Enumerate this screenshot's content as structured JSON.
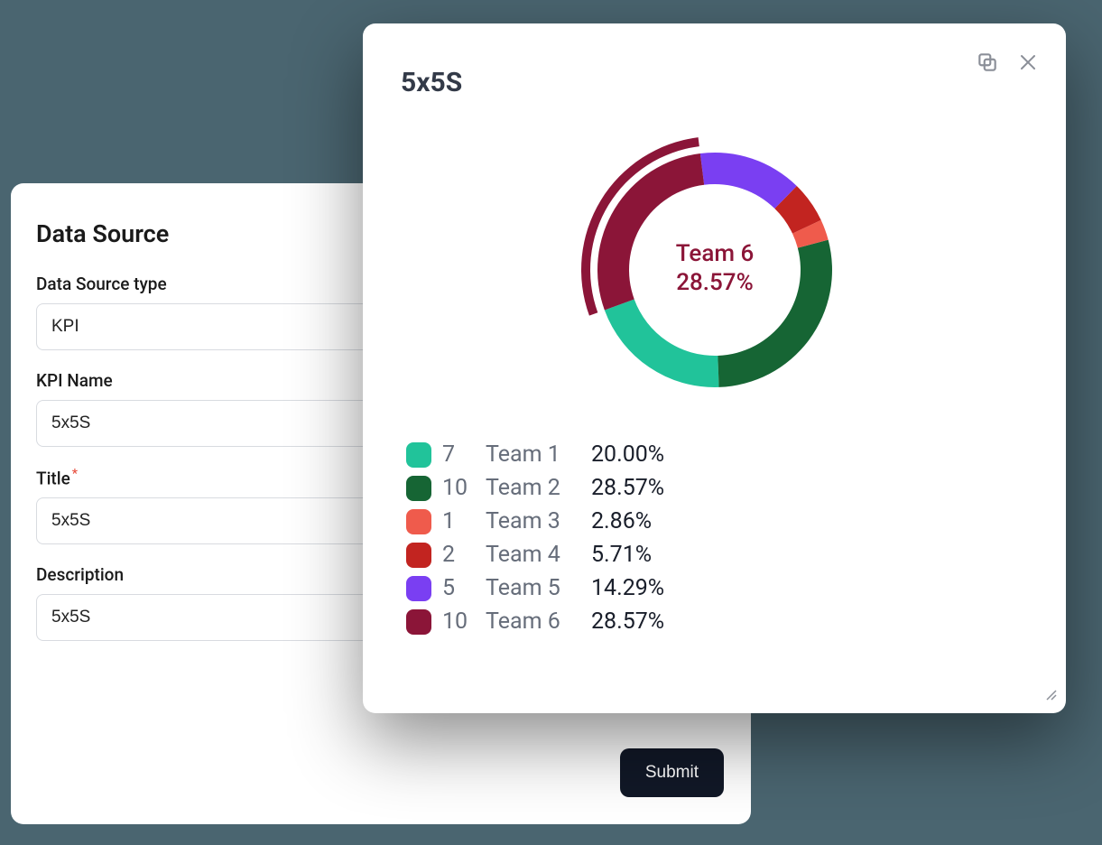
{
  "form": {
    "title": "Data Source",
    "fields": {
      "data_source_type": {
        "label": "Data Source type",
        "value": "KPI"
      },
      "kpi_name": {
        "label": "KPI Name",
        "value": "5x5S"
      },
      "title": {
        "label": "Title",
        "value": "5x5S",
        "required": true
      },
      "description": {
        "label": "Description",
        "value": "5x5S"
      }
    },
    "submit_label": "Submit"
  },
  "chart": {
    "title": "5x5S",
    "center_label": "Team 6",
    "center_value": "28.57%"
  },
  "chart_data": {
    "type": "pie",
    "title": "5x5S",
    "series": [
      {
        "name": "Team 1",
        "count": 7,
        "percent": 20.0,
        "percent_label": "20.00%",
        "color": "#21c39a"
      },
      {
        "name": "Team 2",
        "count": 10,
        "percent": 28.57,
        "percent_label": "28.57%",
        "color": "#166534"
      },
      {
        "name": "Team 3",
        "count": 1,
        "percent": 2.86,
        "percent_label": "2.86%",
        "color": "#ef5b4c"
      },
      {
        "name": "Team 4",
        "count": 2,
        "percent": 5.71,
        "percent_label": "5.71%",
        "color": "#c22420"
      },
      {
        "name": "Team 5",
        "count": 5,
        "percent": 14.29,
        "percent_label": "14.29%",
        "color": "#7a3ff2"
      },
      {
        "name": "Team 6",
        "count": 10,
        "percent": 28.57,
        "percent_label": "28.57%",
        "color": "#8b1538"
      }
    ],
    "highlighted": "Team 6"
  }
}
